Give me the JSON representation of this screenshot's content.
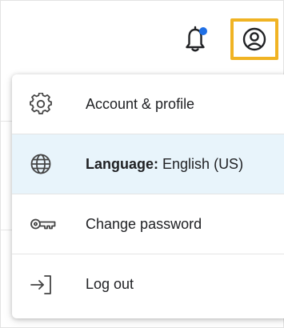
{
  "header": {
    "notifications_icon": "bell-icon",
    "notification_dot_color": "#1f6fe5",
    "account_icon": "account-circle-icon",
    "highlight_color": "#f0b323"
  },
  "menu": {
    "items": [
      {
        "icon": "gear-icon",
        "label": "Account & profile"
      },
      {
        "icon": "globe-icon",
        "label": "Language:",
        "value": "English (US)",
        "active": true
      },
      {
        "icon": "key-icon",
        "label": "Change password"
      },
      {
        "icon": "logout-icon",
        "label": "Log out"
      }
    ],
    "active_bg": "#e8f4fb"
  }
}
